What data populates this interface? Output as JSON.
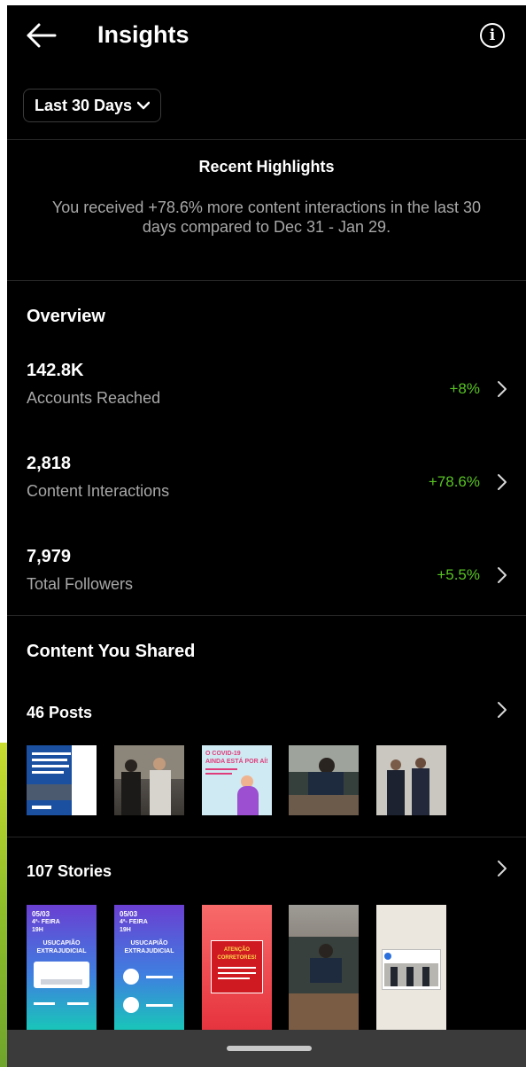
{
  "header": {
    "title": "Insights"
  },
  "range": {
    "label": "Last 30 Days"
  },
  "highlights": {
    "title": "Recent Highlights",
    "text": "You received +78.6% more content interactions in the last 30 days compared to Dec 31 - Jan 29."
  },
  "overview": {
    "title": "Overview",
    "metrics": [
      {
        "value": "142.8K",
        "label": "Accounts Reached",
        "change": "+8%"
      },
      {
        "value": "2,818",
        "label": "Content Interactions",
        "change": "+78.6%"
      },
      {
        "value": "7,979",
        "label": "Total Followers",
        "change": "+5.5%"
      }
    ]
  },
  "content": {
    "title": "Content You Shared",
    "posts": {
      "label": "46 Posts"
    },
    "stories": {
      "label": "107 Stories"
    }
  },
  "thumb_text": {
    "post3_line1": "O COVID-19",
    "post3_line2": "AINDA ESTÁ POR AÍ!",
    "story1_date": "05/03",
    "story1_day": "4ª- FEIRA",
    "story1_time": "19H",
    "story1_topic": "USUCAPIÃO",
    "story1_topic2": "EXTRAJUDICIAL",
    "story2_date": "05/03",
    "story2_day": "4ª- FEIRA",
    "story2_time": "19H",
    "story2_topic": "USUCAPIÃO",
    "story2_topic2": "EXTRAJUDICIAL",
    "story3_text": "ATENÇÃO",
    "story3_text2": "CORRETORES!"
  },
  "colors": {
    "positive": "#58c322",
    "background": "#000000",
    "secondary_text": "#a8a8a8"
  }
}
